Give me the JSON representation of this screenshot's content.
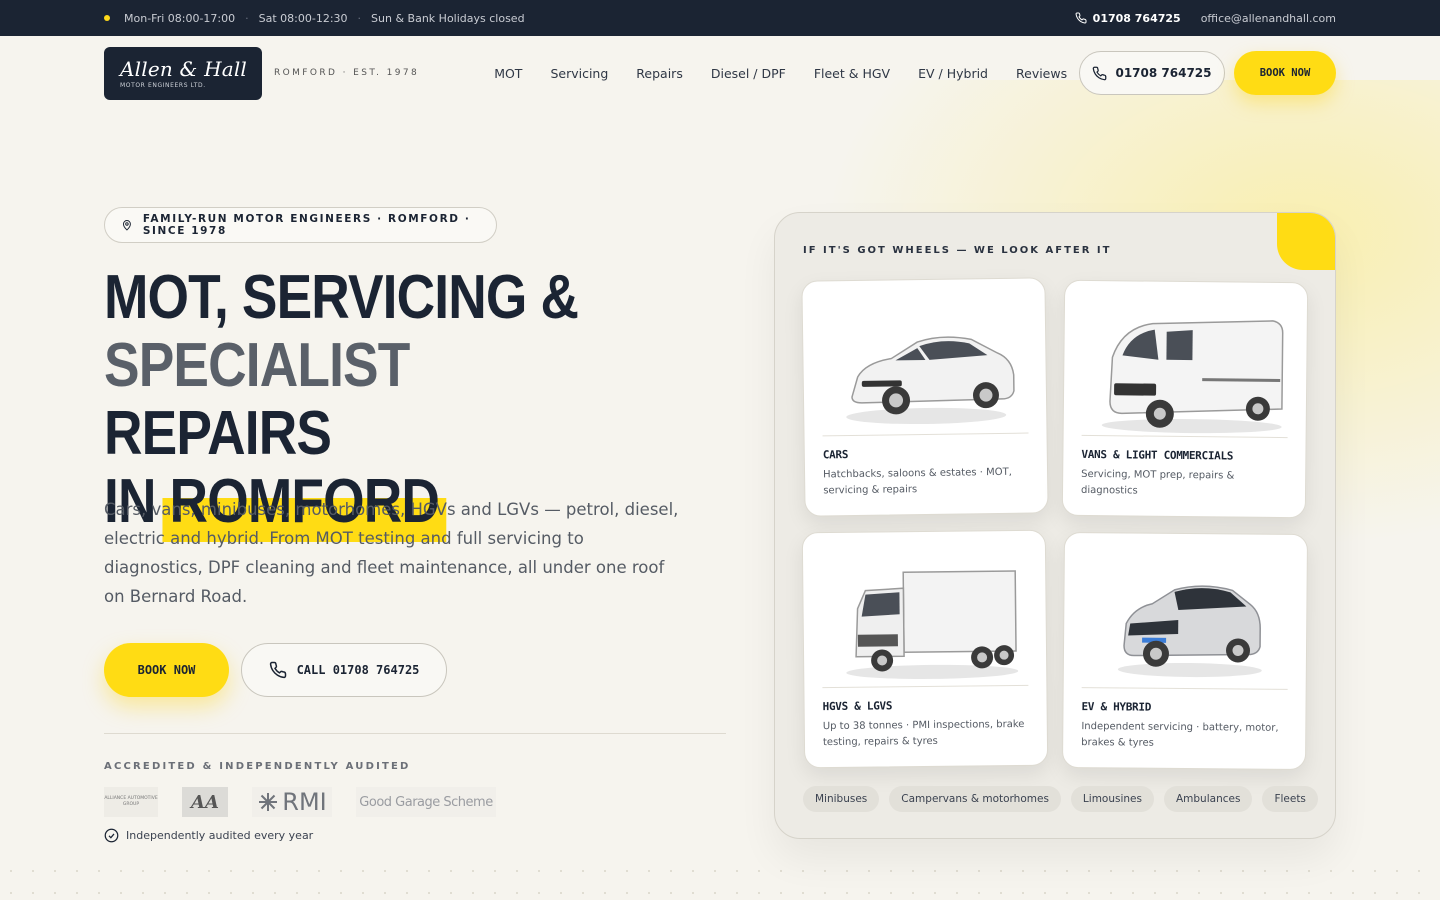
{
  "topbar": {
    "hours_weekday": "Mon-Fri 08:00-17:00",
    "hours_sat": "Sat 08:00-12:30",
    "hours_sun": "Sun & Bank Holidays closed",
    "phone": "01708 764725",
    "email": "office@allenandhall.com"
  },
  "header": {
    "logo_script": "Allen & Hall",
    "logo_sub": "MOTOR ENGINEERS LTD.",
    "tagline": "ROMFORD · EST. 1978",
    "nav": [
      "MOT",
      "Servicing",
      "Repairs",
      "Diesel / DPF",
      "Fleet & HGV",
      "EV / Hybrid",
      "Reviews"
    ],
    "phone": "01708 764725",
    "book_label": "BOOK NOW"
  },
  "hero": {
    "badge": "FAMILY-RUN MOTOR ENGINEERS · ROMFORD · SINCE 1978",
    "headline_line1": "MOT, SERVICING &",
    "headline_line2a": "SPECIALIST",
    "headline_line2b": "REPAIRS",
    "headline_line3a": "IN",
    "headline_line3b": "ROMFORD",
    "lead": "Cars, vans, minibuses, motorhomes, HGVs and LGVs — petrol, diesel, electric and hybrid. From MOT testing and full servicing to diagnostics, DPF cleaning and fleet maintenance, all under one roof on Bernard Road.",
    "book_label": "BOOK NOW",
    "call_label": "CALL 01708 764725",
    "accredited_label": "ACCREDITED & INDEPENDENTLY AUDITED",
    "logos": {
      "alliance": "ALLIANCE AUTOMOTIVE GROUP",
      "aa": "AA",
      "rmi": "RMI",
      "ggs": "Good Garage Scheme"
    },
    "audited_text": "Independently audited every year"
  },
  "panel": {
    "title": "IF IT'S GOT WHEELS — WE LOOK AFTER IT",
    "cards": [
      {
        "name": "CARS",
        "desc": "Hatchbacks, saloons & estates · MOT, servicing & repairs"
      },
      {
        "name": "VANS & LIGHT COMMERCIALS",
        "desc": "Servicing, MOT prep, repairs & diagnostics"
      },
      {
        "name": "HGVS & LGVS",
        "desc": "Up to 38 tonnes · PMI inspections, brake testing, repairs & tyres"
      },
      {
        "name": "EV & HYBRID",
        "desc": "Independent servicing · battery, motor, brakes & tyres"
      }
    ],
    "chips": [
      "Minibuses",
      "Campervans & motorhomes",
      "Limousines",
      "Ambulances",
      "Fleets"
    ]
  },
  "colors": {
    "navy": "#1b2433",
    "accent_yellow": "#ffdc14",
    "background": "#f6f4ee"
  }
}
